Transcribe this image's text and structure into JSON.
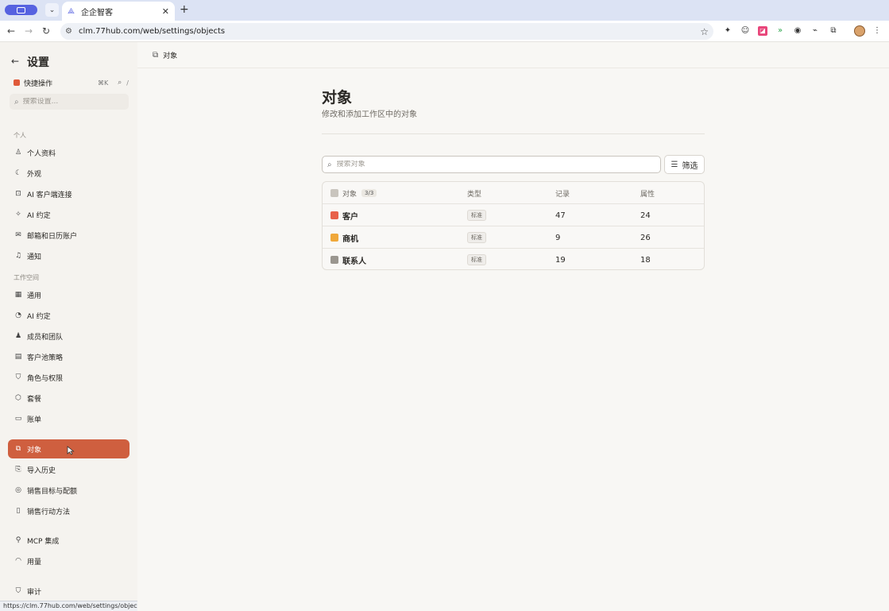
{
  "browser": {
    "tab_title": "企企智客",
    "url": "clm.77hub.com/web/settings/objects",
    "status_url": "https://clm.77hub.com/web/settings/objects"
  },
  "sidebar": {
    "title": "设置",
    "quick_action": {
      "label": "快捷操作",
      "shortcut": "⌘K",
      "slash": "/"
    },
    "search_placeholder": "搜索设置...",
    "section_personal": "个人",
    "section_workspace": "工作空间",
    "personal_items": [
      {
        "label": "个人资料",
        "icon": "user-icon"
      },
      {
        "label": "外观",
        "icon": "moon-icon"
      },
      {
        "label": "AI 客户端连接",
        "icon": "robot-icon"
      },
      {
        "label": "AI 约定",
        "icon": "sparkle-icon"
      },
      {
        "label": "邮箱和日历账户",
        "icon": "mail-icon"
      },
      {
        "label": "通知",
        "icon": "bell-icon"
      }
    ],
    "workspace_items": [
      {
        "label": "通用",
        "icon": "grid-icon"
      },
      {
        "label": "AI 约定",
        "icon": "ai-icon"
      },
      {
        "label": "成员和团队",
        "icon": "users-icon"
      },
      {
        "label": "客户池策略",
        "icon": "archive-icon"
      },
      {
        "label": "角色与权限",
        "icon": "shield-icon"
      },
      {
        "label": "套餐",
        "icon": "package-icon"
      },
      {
        "label": "账单",
        "icon": "card-icon"
      }
    ],
    "data_items": [
      {
        "label": "对象",
        "icon": "objects-icon",
        "active": true
      },
      {
        "label": "导入历史",
        "icon": "import-icon"
      },
      {
        "label": "销售目标与配额",
        "icon": "target-icon"
      },
      {
        "label": "销售行动方法",
        "icon": "book-icon"
      }
    ],
    "extra_items": [
      {
        "label": "MCP 集成",
        "icon": "plug-icon"
      },
      {
        "label": "用量",
        "icon": "gauge-icon"
      }
    ],
    "bottom_items": [
      {
        "label": "审计",
        "icon": "audit-icon"
      }
    ]
  },
  "main": {
    "breadcrumb": "对象",
    "title": "对象",
    "subtitle": "修改和添加工作区中的对象",
    "search_placeholder": "搜索对象",
    "filter_label": "筛选",
    "table": {
      "headers": {
        "name": "对象",
        "count": "3/3",
        "type": "类型",
        "records": "记录",
        "attributes": "属性"
      },
      "rows": [
        {
          "name": "客户",
          "type": "标准",
          "records": "47",
          "attributes": "24",
          "color": "#e8614a"
        },
        {
          "name": "商机",
          "type": "标准",
          "records": "9",
          "attributes": "26",
          "color": "#f0a83a"
        },
        {
          "name": "联系人",
          "type": "标准",
          "records": "19",
          "attributes": "18",
          "color": "#9a968f"
        }
      ]
    }
  },
  "colors": {
    "accent": "#cf5f3f",
    "browser_accent": "#5662e0"
  }
}
